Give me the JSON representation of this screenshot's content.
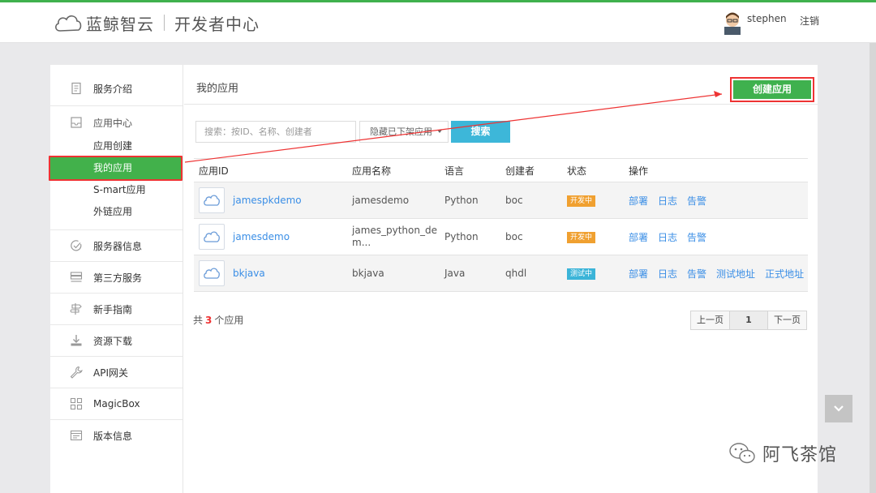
{
  "header": {
    "brand": "蓝鲸智云",
    "subtitle": "开发者中心",
    "username": "stephen",
    "logout_label": "注销"
  },
  "sidebar": {
    "items": [
      {
        "label": "服务介绍",
        "icon": "document-icon"
      },
      {
        "label": "应用中心",
        "icon": "inbox-icon",
        "children": [
          "应用创建",
          "我的应用",
          "S-mart应用",
          "外链应用"
        ],
        "active_child": "我的应用"
      },
      {
        "label": "服务器信息",
        "icon": "check-circle-icon"
      },
      {
        "label": "第三方服务",
        "icon": "server-icon"
      },
      {
        "label": "新手指南",
        "icon": "signpost-icon"
      },
      {
        "label": "资源下载",
        "icon": "download-icon"
      },
      {
        "label": "API网关",
        "icon": "wrench-icon"
      },
      {
        "label": "MagicBox",
        "icon": "grid-icon"
      },
      {
        "label": "版本信息",
        "icon": "version-icon"
      }
    ]
  },
  "main": {
    "title": "我的应用",
    "create_button": "创建应用",
    "search": {
      "placeholder": "搜索：按ID、名称、创建者",
      "filter_value": "隐藏已下架应用",
      "button": "搜索"
    },
    "table": {
      "headers": [
        "应用ID",
        "应用名称",
        "语言",
        "创建者",
        "状态",
        "操作"
      ],
      "rows": [
        {
          "id": "jamespkdemo",
          "name": "jamesdemo",
          "name2": "",
          "lang": "Python",
          "creator": "boc",
          "status": "开发中",
          "ops": [
            "部署",
            "日志",
            "告警"
          ]
        },
        {
          "id": "jamesdemo",
          "name": "james_python_de",
          "name2": "m...",
          "lang": "Python",
          "creator": "boc",
          "status": "开发中",
          "ops": [
            "部署",
            "日志",
            "告警"
          ]
        },
        {
          "id": "bkjava",
          "name": "bkjava",
          "name2": "",
          "lang": "Java",
          "creator": "qhdl",
          "status": "测试中",
          "ops": [
            "部署",
            "日志",
            "告警",
            "测试地址",
            "正式地址"
          ]
        }
      ]
    },
    "total": {
      "prefix": "共",
      "count": "3",
      "suffix": "个应用"
    },
    "pager": {
      "prev": "上一页",
      "current": "1",
      "next": "下一页"
    }
  },
  "watermark": "阿飞茶馆",
  "colors": {
    "accent_green": "#3fb14e",
    "highlight_red": "#e33333",
    "link_blue": "#3a8ee6",
    "dev_orange": "#f0a030",
    "test_blue": "#3bb4d8"
  }
}
